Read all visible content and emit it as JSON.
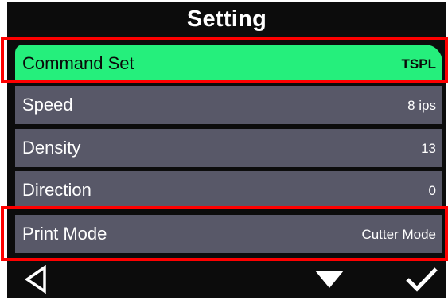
{
  "screen": {
    "title": "Setting"
  },
  "menu": {
    "items": [
      {
        "label": "Command Set",
        "value": "TSPL",
        "selected": true
      },
      {
        "label": "Speed",
        "value": "8 ips",
        "selected": false
      },
      {
        "label": "Density",
        "value": "13",
        "selected": false
      },
      {
        "label": "Direction",
        "value": "0",
        "selected": false
      },
      {
        "label": "Print Mode",
        "value": "Cutter Mode",
        "selected": false
      }
    ]
  },
  "softkeys": {
    "back": "back-arrow-icon",
    "down": "down-triangle-icon",
    "confirm": "checkmark-icon"
  },
  "colors": {
    "screen_background": "#0c0c0c",
    "row_background": "#585868",
    "selected_row": "#25ef7c",
    "annotation_highlight": "#ff0000",
    "text": "#ffffff"
  }
}
